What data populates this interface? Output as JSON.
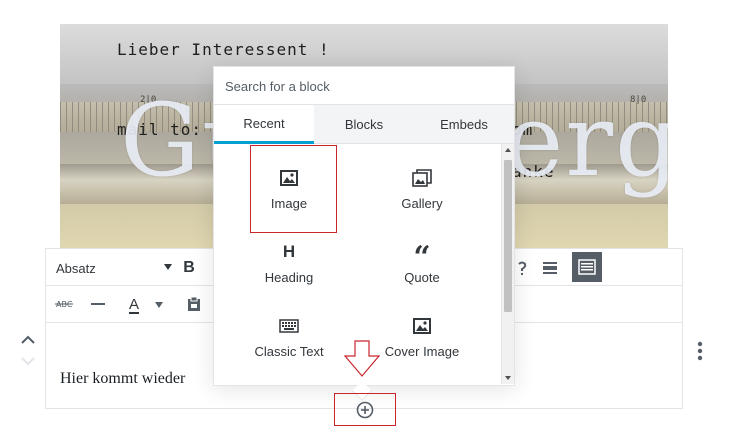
{
  "cover": {
    "title": "Gutenberg",
    "typed_lines": [
      "Lieber Interessent !",
      "mail to:",
      "om",
      "anke"
    ],
    "ruler_numbers": [
      "2|0",
      "8|0"
    ]
  },
  "toolbar": {
    "block_type": "Absatz",
    "bold_label": "B",
    "text_color_label": "A"
  },
  "paragraph": {
    "text": "Hier kommt wieder"
  },
  "inserter": {
    "search_placeholder": "Search for a block",
    "tabs": [
      {
        "label": "Recent",
        "active": true
      },
      {
        "label": "Blocks",
        "active": false
      },
      {
        "label": "Embeds",
        "active": false
      }
    ],
    "items": [
      {
        "label": "Image",
        "icon": "image-icon",
        "glyph": ""
      },
      {
        "label": "Gallery",
        "icon": "gallery-icon",
        "glyph": ""
      },
      {
        "label": "Heading",
        "icon": "heading-icon",
        "glyph": "H"
      },
      {
        "label": "Quote",
        "icon": "quote-icon",
        "glyph": "“"
      },
      {
        "label": "Classic Text",
        "icon": "keyboard-icon",
        "glyph": ""
      },
      {
        "label": "Cover Image",
        "icon": "cover-image-icon",
        "glyph": ""
      }
    ]
  },
  "colors": {
    "accent": "#00a0d2",
    "annotation": "#c9262c",
    "active_button": "#555d66"
  }
}
